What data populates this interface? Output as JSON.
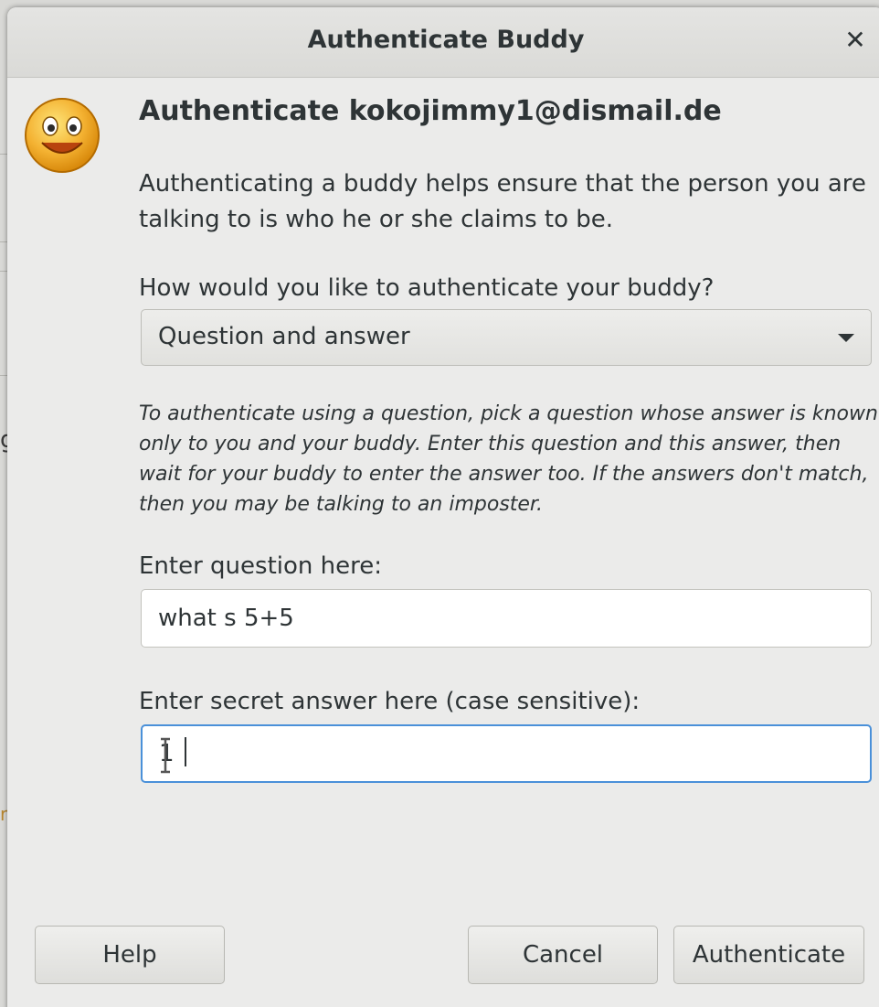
{
  "window": {
    "title": "Authenticate Buddy",
    "close_icon": "close-icon"
  },
  "header": {
    "icon": "smiley-icon",
    "heading": "Authenticate kokojimmy1@dismail.de"
  },
  "intro_text": "Authenticating a buddy helps ensure that the person you are talking to is who he or she claims to be.",
  "method": {
    "label": "How would you like to authenticate your buddy?",
    "selected": "Question and answer"
  },
  "instructions": "To authenticate using a question, pick a question whose answer is known only to you and your buddy.  Enter this question and this answer, then wait for your buddy to enter the answer too.  If the answers don't match, then you may be talking to an imposter.",
  "question": {
    "label": "Enter question here:",
    "value": "what s 5+5"
  },
  "answer": {
    "label": "Enter secret answer here (case sensitive):",
    "value": "1"
  },
  "buttons": {
    "help": "Help",
    "cancel": "Cancel",
    "authenticate": "Authenticate"
  },
  "background": {
    "partial_chars": [
      "g",
      "r"
    ]
  },
  "colors": {
    "focus_border": "#4a90d9",
    "dialog_bg": "#ebebea"
  }
}
